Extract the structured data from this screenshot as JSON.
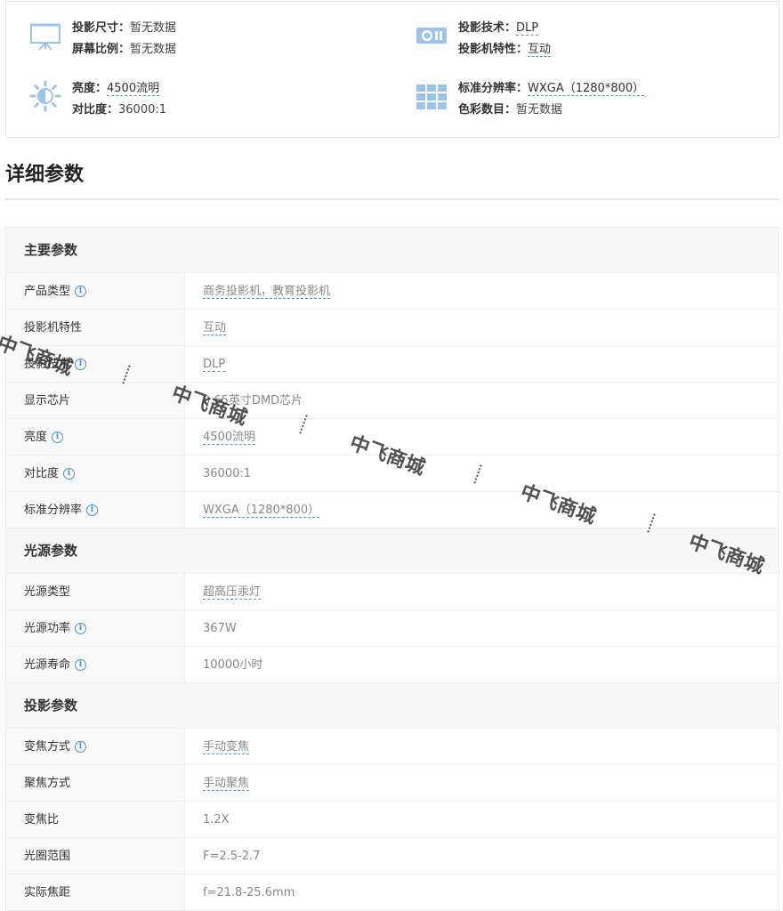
{
  "summary": {
    "size_k": "投影尺寸：",
    "size_v": "暂无数据",
    "ratio_k": "屏幕比例：",
    "ratio_v": "暂无数据",
    "tech_k": "投影技术：",
    "tech_v": "DLP",
    "feature_k": "投影机特性：",
    "feature_v": "互动",
    "bright_k": "亮度：",
    "bright_v": "4500流明",
    "contrast_k": "对比度：",
    "contrast_v": "36000:1",
    "res_k": "标准分辨率：",
    "res_v": "WXGA（1280*800）",
    "color_k": "色彩数目：",
    "color_v": "暂无数据"
  },
  "section_title": "详细参数",
  "groups": [
    {
      "title": "主要参数",
      "rows": [
        {
          "label": "产品类型",
          "value": "商务投影机，教育投影机"
        },
        {
          "label": "投影机特性",
          "value": "互动"
        },
        {
          "label": "投影技术",
          "value": "DLP"
        },
        {
          "label": "显示芯片",
          "value": "0.65英寸DMD芯片"
        },
        {
          "label": "亮度",
          "value": "4500流明"
        },
        {
          "label": "对比度",
          "value": "36000:1"
        },
        {
          "label": "标准分辨率",
          "value": "WXGA（1280*800）"
        }
      ]
    },
    {
      "title": "光源参数",
      "rows": [
        {
          "label": "光源类型",
          "value": "超高压汞灯"
        },
        {
          "label": "光源功率",
          "value": "367W"
        },
        {
          "label": "光源寿命",
          "value": "10000小时"
        }
      ]
    },
    {
      "title": "投影参数",
      "rows": [
        {
          "label": "变焦方式",
          "value": "手动变焦"
        },
        {
          "label": "聚焦方式",
          "value": "手动聚焦"
        },
        {
          "label": "变焦比",
          "value": "1.2X"
        },
        {
          "label": "光圈范围",
          "value": "F=2.5-2.7"
        },
        {
          "label": "实际焦距",
          "value": "f=21.8-25.6mm"
        }
      ]
    }
  ],
  "watermark": "中飞商城",
  "colors": {
    "accent": "#4a90d9",
    "icon": "#9cc3ea"
  }
}
